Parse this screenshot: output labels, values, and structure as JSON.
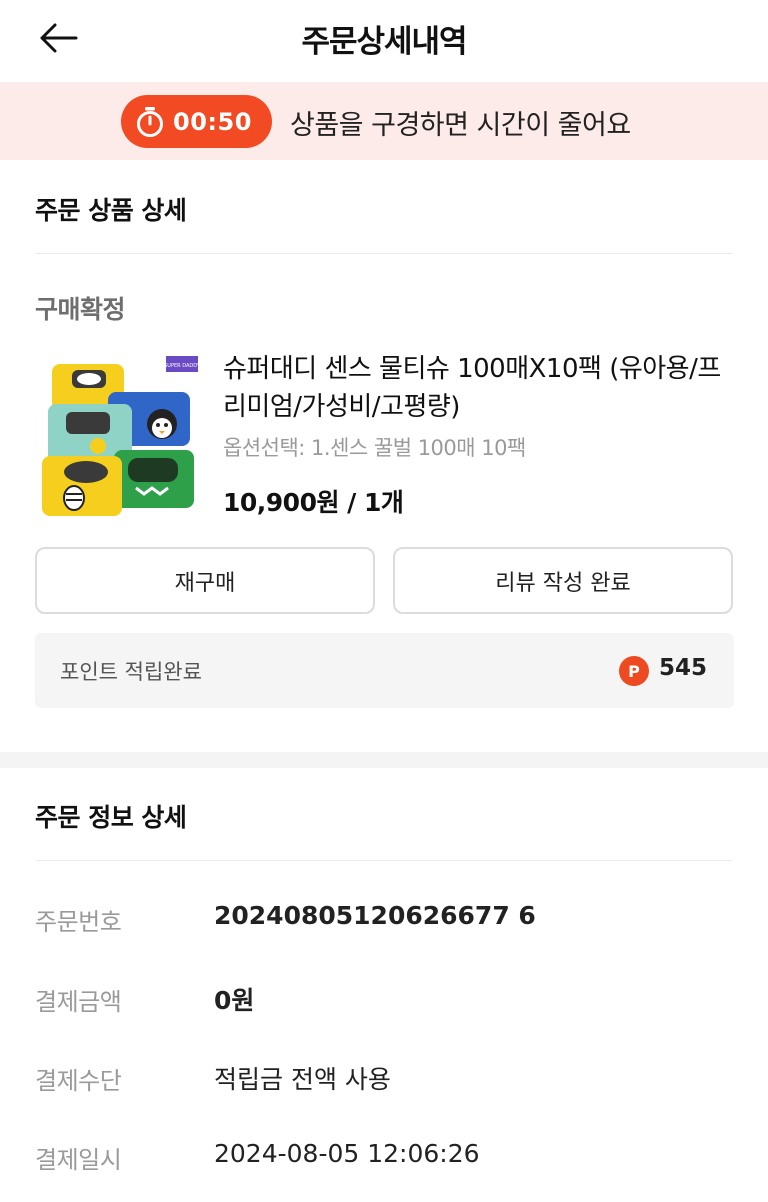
{
  "header": {
    "title": "주문상세내역"
  },
  "timer": {
    "value": "00:50",
    "message": "상품을 구경하면 시간이 줄어요"
  },
  "order_products": {
    "section_title": "주문 상품 상세",
    "status": "구매확정",
    "product": {
      "name": "슈퍼대디 센스 물티슈 100매X10팩 (유아용/프리미엄/가성비/고평량)",
      "option": "옵션선택: 1.센스 꿀벌 100매 10팩",
      "price": "10,900원 / 1개",
      "brand_logo_text": "SUPER DADDY"
    },
    "buttons": {
      "rebuy": "재구매",
      "review": "리뷰 작성 완료"
    },
    "points": {
      "label": "포인트 적립완료",
      "icon_letter": "P",
      "value": "545"
    }
  },
  "order_info": {
    "section_title": "주문 정보 상세",
    "rows": [
      {
        "label": "주문번호",
        "value": "20240805120626677 6"
      },
      {
        "label": "결제금액",
        "value": "0원"
      },
      {
        "label": "결제수단",
        "value": "적립금 전액 사용"
      },
      {
        "label": "결제일시",
        "value": "2024-08-05 12:06:26"
      }
    ]
  },
  "colors": {
    "accent": "#f24a22",
    "banner_bg": "#fcebe8",
    "muted_text": "#9a9a9a"
  }
}
